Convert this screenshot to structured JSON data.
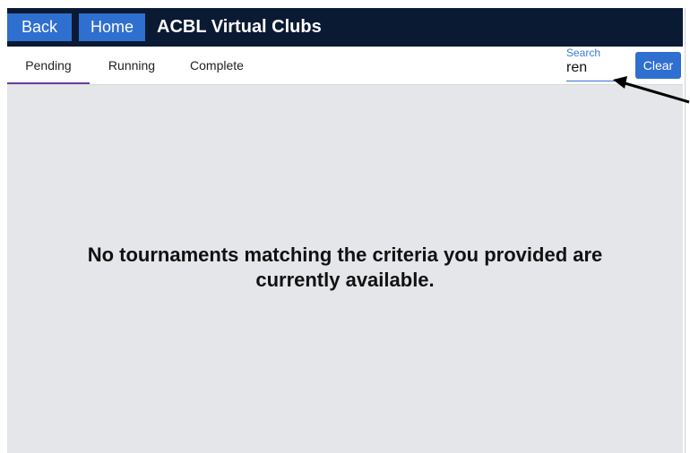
{
  "header": {
    "back_label": "Back",
    "home_label": "Home",
    "title": "ACBL Virtual Clubs"
  },
  "tabs": [
    {
      "label": "Pending",
      "selected": true
    },
    {
      "label": "Running",
      "selected": false
    },
    {
      "label": "Complete",
      "selected": false
    }
  ],
  "search": {
    "label": "Search",
    "value": "ren",
    "clear_label": "Clear"
  },
  "main": {
    "empty_message": "No tournaments matching the criteria you provided are currently available."
  },
  "colors": {
    "header_bg": "#0b1a33",
    "button_blue": "#2f6fd0",
    "tab_indicator": "#6b3fa0",
    "content_bg": "#e4e6e9"
  },
  "annotation": {
    "icon": "arrow-icon"
  }
}
